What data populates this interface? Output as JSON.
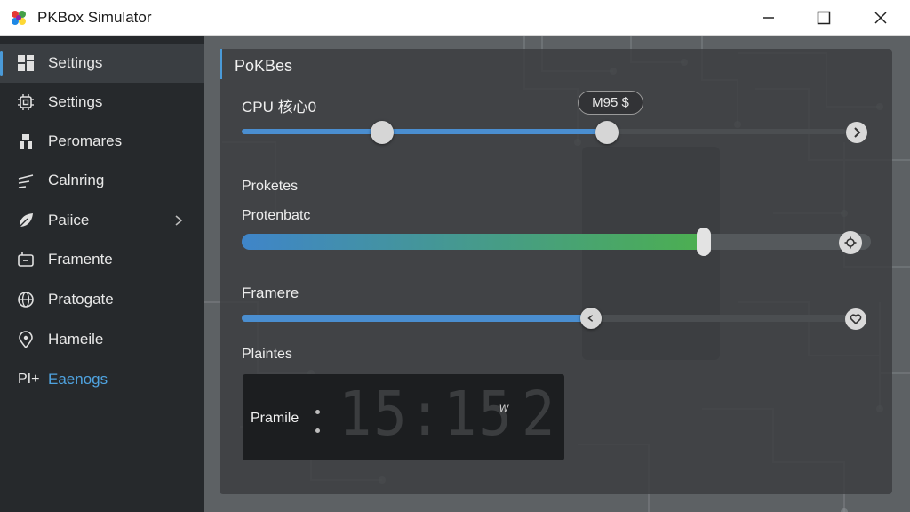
{
  "window": {
    "title": "PKBox Simulator"
  },
  "sidebar": {
    "items": [
      {
        "label": "Settings",
        "icon": "dashboard-icon",
        "active": true
      },
      {
        "label": "Settings",
        "icon": "chip-icon"
      },
      {
        "label": "Peromares",
        "icon": "bar-chart-icon"
      },
      {
        "label": "Calnring",
        "icon": "lines-icon"
      },
      {
        "label": "Paiice",
        "icon": "leaf-icon",
        "has_submenu": true
      },
      {
        "label": "Framente",
        "icon": "folder-icon"
      },
      {
        "label": "Pratogate",
        "icon": "globe-icon"
      },
      {
        "label": "Hameile",
        "icon": "location-pin-icon"
      },
      {
        "label": "Eaenogs",
        "prefix": "PI+",
        "accent": true
      }
    ]
  },
  "panel": {
    "title": "PoKBes",
    "cpu": {
      "label": "CPU 核心0",
      "value_text": "M95 $",
      "range_low": 0.232,
      "range_high": 0.605
    },
    "section_label": "Proketes",
    "progress": {
      "label": "Protenbatc",
      "value": 0.735
    },
    "frame": {
      "label": "Framere",
      "value": 0.57
    },
    "clock": {
      "section_label": "Plaintes",
      "label": "Pramile",
      "digits": "15:15",
      "small_text": "w",
      "last_digit": "2"
    }
  },
  "colors": {
    "accent": "#4a9ad8",
    "green": "#4caf50",
    "sidebar_bg": "#26292c",
    "panel_bg": "#3a3d40"
  }
}
